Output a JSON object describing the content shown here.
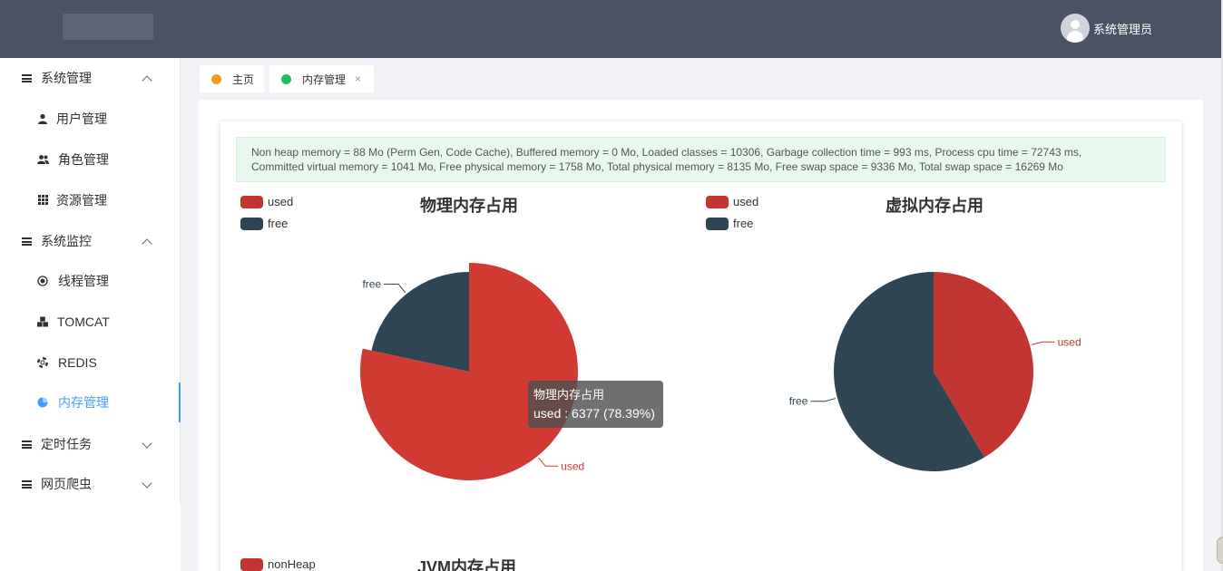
{
  "header": {
    "user_name": "系统管理员"
  },
  "sidebar": {
    "groups": [
      {
        "label": "系统管理",
        "expanded": true,
        "items": [
          {
            "label": "用户管理",
            "icon": "user-icon"
          },
          {
            "label": "角色管理",
            "icon": "users-icon"
          },
          {
            "label": "资源管理",
            "icon": "grid-icon"
          }
        ]
      },
      {
        "label": "系统监控",
        "expanded": true,
        "items": [
          {
            "label": "线程管理",
            "icon": "radio-icon"
          },
          {
            "label": "TOMCAT",
            "icon": "cubes-icon"
          },
          {
            "label": "REDIS",
            "icon": "lifebuoy-icon"
          },
          {
            "label": "内存管理",
            "icon": "pie-icon",
            "active": true
          }
        ]
      },
      {
        "label": "定时任务",
        "expanded": false
      },
      {
        "label": "网页爬虫",
        "expanded": false
      }
    ]
  },
  "tabs": [
    {
      "label": "主页",
      "dot_color": "#f59c1a",
      "closable": false
    },
    {
      "label": "内存管理",
      "dot_color": "#1ebd62",
      "closable": true,
      "close": "×"
    }
  ],
  "info": {
    "line1": "Non heap memory = 88 Mo (Perm Gen, Code Cache), Buffered memory = 0 Mo, Loaded classes = 10306, Garbage collection time = 993 ms, Process cpu time = 72743 ms,",
    "line2": "Committed virtual memory = 1041 Mo, Free physical memory = 1758 Mo, Total physical memory = 8135 Mo, Free swap space = 9336 Mo, Total swap space = 16269 Mo"
  },
  "colors": {
    "used": "#d23b34",
    "free": "#2f4554",
    "used_alt": "#c23531",
    "accent": "#409eff"
  },
  "chart_data": [
    {
      "type": "pie",
      "title": "物理内存占用",
      "legend": [
        "used",
        "free"
      ],
      "legend_position": "top-left",
      "slices": [
        {
          "name": "used",
          "value": 6377,
          "percent": 78.39
        },
        {
          "name": "free",
          "value": 1758
        }
      ],
      "tooltip": {
        "title": "物理内存占用",
        "text": "used : 6377 (78.39%)"
      }
    },
    {
      "type": "pie",
      "title": "虚拟内存占用",
      "legend": [
        "used",
        "free"
      ],
      "legend_position": "top-left",
      "slices": [
        {
          "name": "used",
          "percent": 41.5
        },
        {
          "name": "free",
          "percent": 58.5
        }
      ]
    },
    {
      "type": "pie",
      "title": "JVM内存占用",
      "legend": [
        "nonHeap"
      ],
      "legend_position": "top-left"
    }
  ]
}
